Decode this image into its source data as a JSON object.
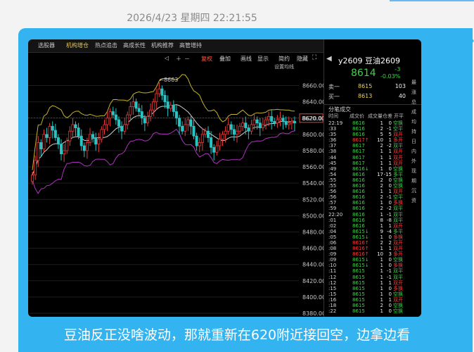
{
  "timestamp": "2026/4/23 星期四 22:21:55",
  "caption": "豆油反正没啥波动，那就重新在620附近接回空，边拿边看",
  "toolbar": {
    "items": [
      "选股器",
      "机构增仓",
      "热点追击",
      "高成长性",
      "机构推荐",
      "高管增持"
    ],
    "active_index": 1
  },
  "controls": {
    "items": [
      "复权",
      "叠加",
      "画线",
      "显示",
      "简约",
      "隐藏"
    ],
    "indicator": "设置均线"
  },
  "chart_data": {
    "type": "candlestick",
    "ylim": [
      8380,
      8670
    ],
    "y_ticks": [
      8660,
      8640,
      8620,
      8600,
      8580,
      8560,
      8540,
      8520,
      8500,
      8480,
      8460,
      8440,
      8420,
      8400,
      8380
    ],
    "y_tick_labels": [
      "8660.00",
      "8640.00",
      "8620.00",
      "8600.00",
      "8580.00",
      "8560.00",
      "8540.00",
      "8520.00",
      "8500.00",
      "8480.00",
      "8460.00",
      "8440.00",
      "8420.00",
      "8400.00",
      "8380.00"
    ],
    "current_price_label": "8620.00",
    "peak_annotation": "8663",
    "closes": [
      8550,
      8568,
      8590,
      8582,
      8600,
      8596,
      8610,
      8605,
      8596,
      8588,
      8576,
      8580,
      8592,
      8604,
      8612,
      8608,
      8598,
      8586,
      8580,
      8590,
      8600,
      8596,
      8588,
      8594,
      8606,
      8612,
      8620,
      8628,
      8624,
      8618,
      8610,
      8604,
      8612,
      8624,
      8634,
      8640,
      8632,
      8628,
      8620,
      8614,
      8622,
      8630,
      8640,
      8650,
      8656,
      8648,
      8640,
      8632,
      8636,
      8628,
      8620,
      8610,
      8604,
      8612,
      8618,
      8610,
      8598,
      8586,
      8590,
      8600,
      8604,
      8596,
      8584,
      8578,
      8586,
      8594,
      8600,
      8604,
      8612,
      8606,
      8600,
      8604,
      8610,
      8614,
      8608,
      8604,
      8612,
      8618,
      8614,
      8608,
      8612,
      8618,
      8622,
      8616,
      8614,
      8618,
      8620,
      8616,
      8612,
      8614,
      8616,
      8614
    ]
  },
  "quote": {
    "contract": "y2609",
    "name": "豆油2609",
    "last": "8614",
    "change": "-3",
    "change_pct": "-0.03%",
    "ask_label": "卖一",
    "ask_price": "8615",
    "ask_vol": "103",
    "bid_label": "买一",
    "bid_price": "8613",
    "bid_vol": "40",
    "tab_label": "分笔成交",
    "columns": [
      "时间",
      "成交价",
      "成交量",
      "仓差",
      "开平"
    ],
    "ticks": [
      {
        "time": "22:19",
        "price": "8616",
        "vol": "1",
        "oi": "0",
        "type": "空换",
        "dir": ""
      },
      {
        "time": ":33",
        "price": "8616",
        "vol": "2",
        "oi": "-1",
        "type": "空平",
        "dir": ""
      },
      {
        "time": ":35",
        "price": "8616",
        "vol": "5",
        "oi": "5",
        "type": "双开",
        "dir": ""
      },
      {
        "time": ":36",
        "price": "8617",
        "vol": "10",
        "oi": "1",
        "type": "多开",
        "dir": "up"
      },
      {
        "time": ":37",
        "price": "8617",
        "vol": "2",
        "oi": "-2",
        "type": "双平",
        "dir": ""
      },
      {
        "time": ":38",
        "price": "8617",
        "vol": "1",
        "oi": "1",
        "type": "双开",
        "dir": ""
      },
      {
        "time": ":44",
        "price": "8617",
        "vol": "1",
        "oi": "1",
        "type": "双开",
        "dir": ""
      },
      {
        "time": ":45",
        "price": "8617",
        "vol": "1",
        "oi": "1",
        "type": "双开",
        "dir": ""
      },
      {
        "time": ":49",
        "price": "8616",
        "vol": "1",
        "oi": "0",
        "type": "空换",
        "dir": "down"
      },
      {
        "time": ":54",
        "price": "8616",
        "vol": "17",
        "oi": "-15",
        "type": "多平",
        "dir": ""
      },
      {
        "time": ":55",
        "price": "8616",
        "vol": "2",
        "oi": "0",
        "type": "空换",
        "dir": ""
      },
      {
        "time": ":55",
        "price": "8616",
        "vol": "2",
        "oi": "0",
        "type": "空换",
        "dir": ""
      },
      {
        "time": ":56",
        "price": "8616",
        "vol": "1",
        "oi": "1",
        "type": "双开",
        "dir": ""
      },
      {
        "time": ":56",
        "price": "8616",
        "vol": "2",
        "oi": "-1",
        "type": "空平",
        "dir": ""
      },
      {
        "time": ":57",
        "price": "8616",
        "vol": "1",
        "oi": "0",
        "type": "多换",
        "dir": ""
      },
      {
        "time": ":59",
        "price": "8616",
        "vol": "2",
        "oi": "-2",
        "type": "双平",
        "dir": ""
      },
      {
        "time": "22:20",
        "price": "8616",
        "vol": "1",
        "oi": "-1",
        "type": "双平",
        "dir": ""
      },
      {
        "time": ":01",
        "price": "8616",
        "vol": "8",
        "oi": "-8",
        "type": "双平",
        "dir": ""
      },
      {
        "time": ":02",
        "price": "8616",
        "vol": "1",
        "oi": "1",
        "type": "双开",
        "dir": ""
      },
      {
        "time": ":04",
        "price": "8615",
        "vol": "9",
        "oi": "-4",
        "type": "多平",
        "dir": "down"
      },
      {
        "time": ":05",
        "price": "8615",
        "vol": "1",
        "oi": "0",
        "type": "多换",
        "dir": "down"
      },
      {
        "time": ":06",
        "price": "8616",
        "vol": "2",
        "oi": "2",
        "type": "双开",
        "dir": "up"
      },
      {
        "time": ":08",
        "price": "8616",
        "vol": "1",
        "oi": "1",
        "type": "双开",
        "dir": "up"
      },
      {
        "time": ":09",
        "price": "8616",
        "vol": "10",
        "oi": "3",
        "type": "多开",
        "dir": "up"
      },
      {
        "time": ":09",
        "price": "8615",
        "vol": "1",
        "oi": "0",
        "type": "空换",
        "dir": "down"
      },
      {
        "time": ":10",
        "price": "8615",
        "vol": "1",
        "oi": "0",
        "type": "多换",
        "dir": "down"
      },
      {
        "time": ":11",
        "price": "8615",
        "vol": "1",
        "oi": "-1",
        "type": "双平",
        "dir": ""
      },
      {
        "time": ":12",
        "price": "8615",
        "vol": "1",
        "oi": "-1",
        "type": "双平",
        "dir": ""
      },
      {
        "time": ":12",
        "price": "8615",
        "vol": "1",
        "oi": "1",
        "type": "双开",
        "dir": ""
      },
      {
        "time": ":15",
        "price": "8615",
        "vol": "1",
        "oi": "0",
        "type": "多换",
        "dir": ""
      },
      {
        "time": ":15",
        "price": "8615",
        "vol": "1",
        "oi": "0",
        "type": "空换",
        "dir": ""
      },
      {
        "time": ":16",
        "price": "8615",
        "vol": "1",
        "oi": "1",
        "type": "双开",
        "dir": ""
      },
      {
        "time": ":18",
        "price": "8615",
        "vol": "2",
        "oi": "0",
        "type": "空换",
        "dir": ""
      },
      {
        "time": ":22",
        "price": "8615",
        "vol": "1",
        "oi": "0",
        "type": "空换",
        "dir": ""
      }
    ],
    "side_labels": [
      "最",
      "涨",
      "总",
      "成",
      "均",
      "持",
      "日",
      "内",
      "外",
      "现",
      "期",
      "沉",
      "资"
    ]
  },
  "colors": {
    "up": "#ff3b3b",
    "down": "#3ed14a",
    "candle_up": "#e63c3c",
    "candle_down": "#27c4c4",
    "boll_upper": "#c8b42a",
    "boll_lower": "#b030c0",
    "boll_mid": "#d0d0d0",
    "yellow": "#f0d24a"
  }
}
